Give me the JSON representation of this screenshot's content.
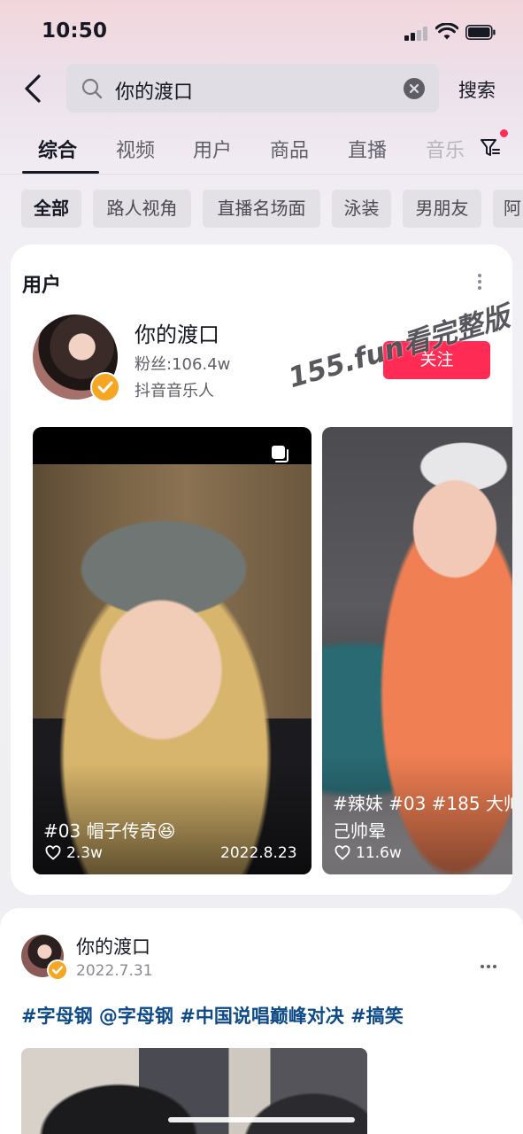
{
  "status_bar": {
    "time": "10:50"
  },
  "search": {
    "query": "你的渡口",
    "submit_label": "搜索"
  },
  "tabs": [
    {
      "label": "综合",
      "active": true
    },
    {
      "label": "视频"
    },
    {
      "label": "用户"
    },
    {
      "label": "商品"
    },
    {
      "label": "直播"
    },
    {
      "label": "音乐"
    }
  ],
  "chips": [
    {
      "label": "全部",
      "active": true
    },
    {
      "label": "路人视角"
    },
    {
      "label": "直播名场面"
    },
    {
      "label": "泳装"
    },
    {
      "label": "男朋友"
    },
    {
      "label": "阿"
    }
  ],
  "user_section": {
    "title": "用户",
    "user": {
      "name": "你的渡口",
      "fans": "粉丝:106.4w",
      "tag": "抖音音乐人",
      "follow_label": "关注"
    },
    "watermark": "155.fun看完整版",
    "videos": [
      {
        "caption": "#03 帽子传奇😆",
        "likes": "2.3w",
        "date": "2022.8.23"
      },
      {
        "caption_line1": "#辣妹 #03 #185 大帅",
        "caption_line2": "己帅晕",
        "likes": "11.6w"
      }
    ]
  },
  "post": {
    "author": "你的渡口",
    "date": "2022.7.31",
    "tags": "#字母钢 @字母钢 #中国说唱巅峰对决 #搞笑"
  },
  "colors": {
    "accent": "#fe2c55",
    "verified": "#f5a623",
    "tag_link": "#0d4a8a"
  }
}
